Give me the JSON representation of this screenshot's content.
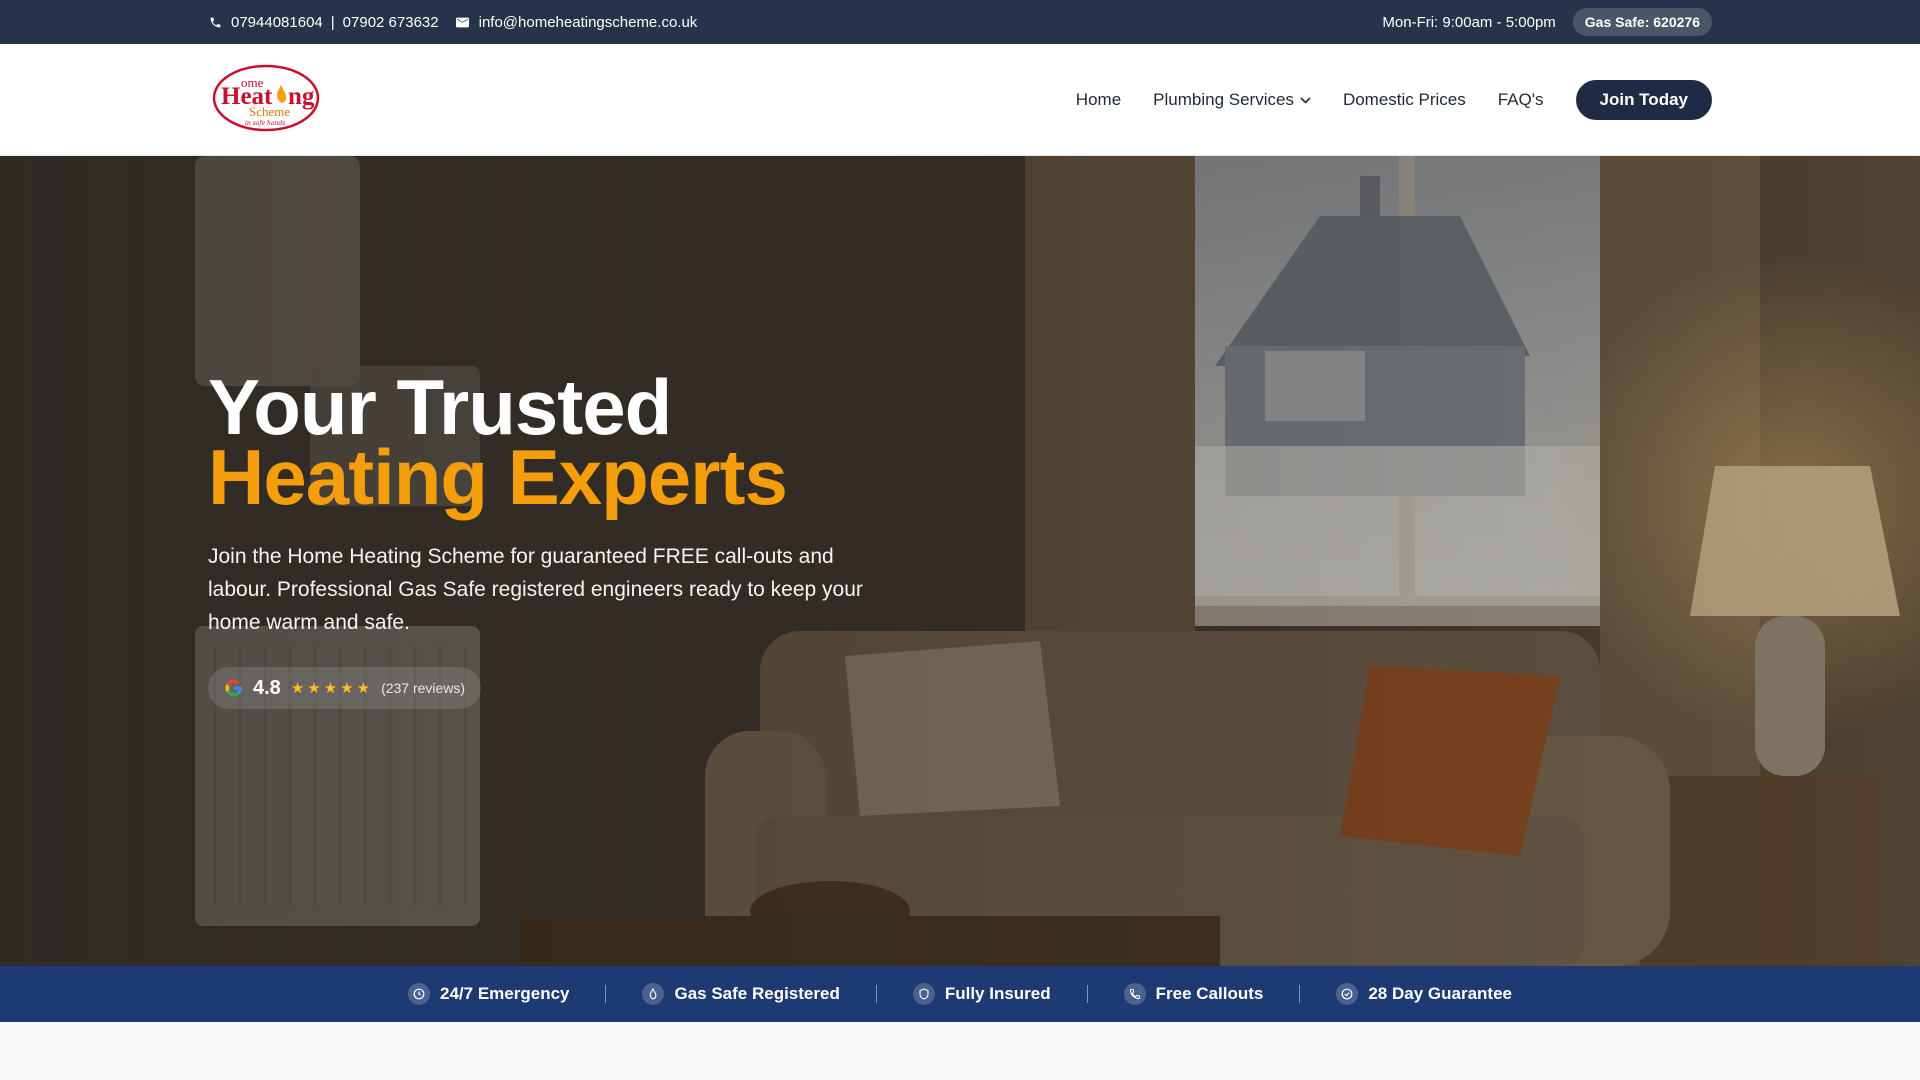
{
  "topbar": {
    "phone1": "07944081604",
    "separator": "|",
    "phone2": "07902 673632",
    "email": "info@homeheatingscheme.co.uk",
    "hours": "Mon-Fri: 9:00am - 5:00pm",
    "gas_safe_badge": "Gas Safe: 620276"
  },
  "logo": {
    "line1": "ome",
    "line2": "Heat",
    "line2b": "ng",
    "line3": "Scheme",
    "tagline": "in safe hands"
  },
  "nav": {
    "home": "Home",
    "plumbing": "Plumbing Services",
    "prices": "Domestic Prices",
    "faq": "FAQ's",
    "join": "Join Today"
  },
  "hero": {
    "title_line1": "Your Trusted",
    "title_line2": "Heating Experts",
    "lead": "Join the Home Heating Scheme for guaranteed FREE call-outs and labour. Professional Gas Safe registered engineers ready to keep your home warm and safe.",
    "rating_score": "4.8",
    "rating_stars": "★★★★★",
    "rating_reviews": "(237 reviews)"
  },
  "features": [
    {
      "label": "24/7 Emergency",
      "icon": "clock-icon"
    },
    {
      "label": "Gas Safe Registered",
      "icon": "flame-icon"
    },
    {
      "label": "Fully Insured",
      "icon": "shield-icon"
    },
    {
      "label": "Free Callouts",
      "icon": "phone-icon"
    },
    {
      "label": "28 Day Guarantee",
      "icon": "check-circle-icon"
    }
  ],
  "colors": {
    "topbar_bg": "#26334a",
    "accent_orange": "#f59e0b",
    "navy_button": "#1f2a44",
    "strip_bg": "#1e3a72"
  }
}
